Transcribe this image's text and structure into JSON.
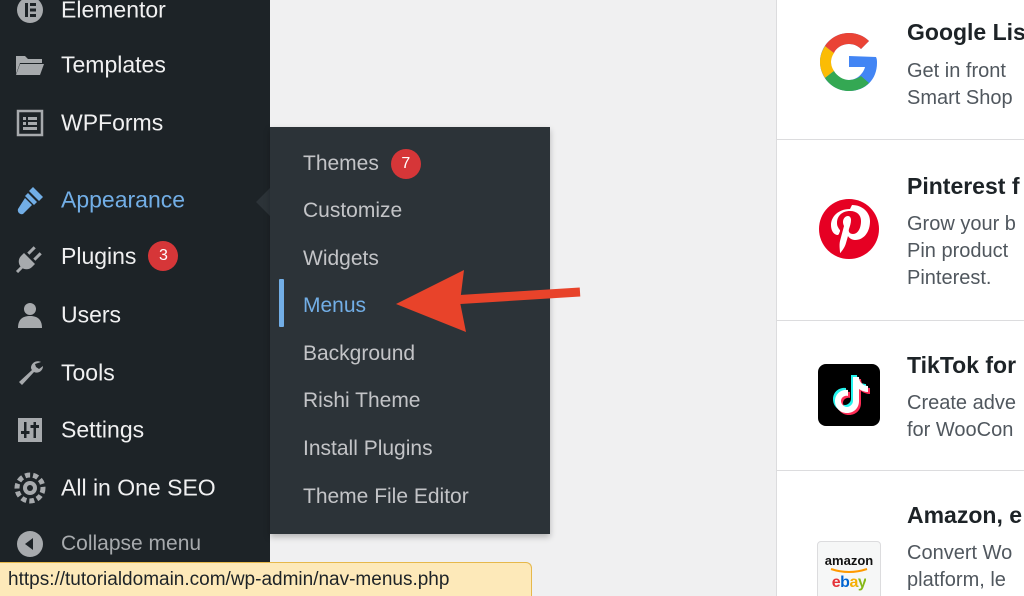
{
  "sidebar": {
    "items": [
      {
        "label": "Elementor",
        "icon": "elementor-icon"
      },
      {
        "label": "Templates",
        "icon": "folder-icon"
      },
      {
        "label": "WPForms",
        "icon": "wpforms-icon"
      },
      {
        "label": "Appearance",
        "icon": "paintbrush-icon",
        "active": true
      },
      {
        "label": "Plugins",
        "icon": "plug-icon",
        "badge": "3"
      },
      {
        "label": "Users",
        "icon": "user-icon"
      },
      {
        "label": "Tools",
        "icon": "wrench-icon"
      },
      {
        "label": "Settings",
        "icon": "sliders-icon"
      },
      {
        "label": "All in One SEO",
        "icon": "aioseo-icon"
      },
      {
        "label": "Collapse menu",
        "icon": "collapse-icon"
      }
    ]
  },
  "submenu": {
    "items": [
      {
        "label": "Themes",
        "badge": "7"
      },
      {
        "label": "Customize"
      },
      {
        "label": "Widgets"
      },
      {
        "label": "Menus",
        "current": true
      },
      {
        "label": "Background"
      },
      {
        "label": "Rishi Theme"
      },
      {
        "label": "Install Plugins"
      },
      {
        "label": "Theme File Editor"
      }
    ]
  },
  "extensions": [
    {
      "title": "Google Lis",
      "desc": [
        "Get in front",
        "Smart Shop"
      ],
      "logo": "google-logo-icon"
    },
    {
      "title": "Pinterest f",
      "desc": [
        "Grow your b",
        "Pin product",
        "Pinterest."
      ],
      "logo": "pinterest-logo-icon"
    },
    {
      "title": "TikTok for",
      "desc": [
        "Create adve",
        "for WooCon"
      ],
      "logo": "tiktok-logo-icon"
    },
    {
      "title": "Amazon, e",
      "desc": [
        "Convert Wo",
        "platform, le"
      ],
      "logo": "amazon-ebay-logo-icon",
      "logo_text": [
        "amazon",
        "ebay"
      ]
    }
  ],
  "status_bar": {
    "url": "https://tutorialdomain.com/wp-admin/nav-menus.php"
  },
  "colors": {
    "sidebar_bg": "#1d2327",
    "flyout_bg": "#2c3338",
    "accent": "#72aee6",
    "badge": "#d63638",
    "arrow": "#e8432a",
    "status_bg": "#fde9b9"
  }
}
